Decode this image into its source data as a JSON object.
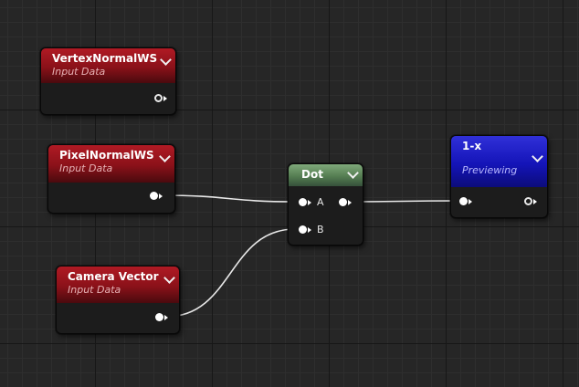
{
  "canvas": {
    "grid": "dark-blueprint"
  },
  "nodes": [
    {
      "id": "vertexnormalws",
      "title": "VertexNormalWS",
      "subtitle": "Input Data",
      "color": "#9c1620"
    },
    {
      "id": "pixelnormalws",
      "title": "PixelNormalWS",
      "subtitle": "Input Data",
      "color": "#9c1620"
    },
    {
      "id": "cameravector",
      "title": "Camera Vector",
      "subtitle": "Input Data",
      "color": "#9c1620"
    },
    {
      "id": "dot",
      "title": "Dot",
      "inputs": [
        "A",
        "B"
      ],
      "color": "#5f8a5c"
    },
    {
      "id": "oneminusx",
      "title": "1-x",
      "subtitle": "Previewing",
      "color": "#1a1ac4"
    }
  ],
  "icons": {
    "collapse": "chevron-down-icon",
    "output_pin": "exec-pin-icon",
    "preview_pin": "hollow-pin-icon"
  },
  "wires": [
    {
      "from": "PixelNormalWS",
      "to": "Dot.A"
    },
    {
      "from": "Camera Vector",
      "to": "Dot.B"
    },
    {
      "from": "Dot",
      "to": "1-x"
    }
  ]
}
